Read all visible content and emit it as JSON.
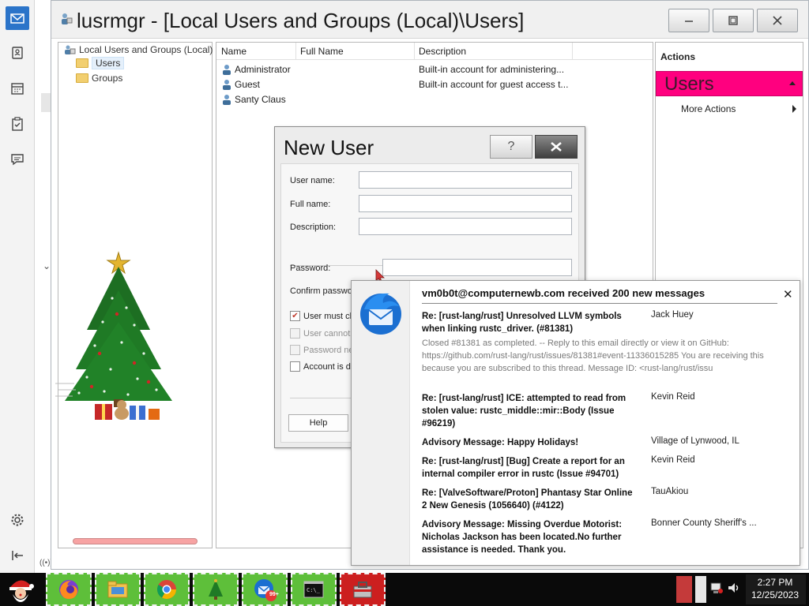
{
  "window": {
    "title": "lusrmgr - [Local Users and Groups (Local)\\Users]"
  },
  "tree": {
    "root": "Local Users and Groups (Local)",
    "items": [
      "Users",
      "Groups"
    ]
  },
  "list": {
    "columns": [
      "Name",
      "Full Name",
      "Description"
    ],
    "rows": [
      {
        "name": "Administrator",
        "full_name": "",
        "description": "Built-in account for administering..."
      },
      {
        "name": "Guest",
        "full_name": "",
        "description": "Built-in account for guest access t..."
      },
      {
        "name": "Santy Claus",
        "full_name": "",
        "description": ""
      }
    ]
  },
  "actions": {
    "title": "Actions",
    "section": "Users",
    "more": "More Actions"
  },
  "dialog": {
    "title": "New User",
    "help_glyph": "?",
    "fields": {
      "user_name": "User name:",
      "full_name": "Full name:",
      "description": "Description:",
      "password": "Password:",
      "confirm": "Confirm passwo"
    },
    "checks": [
      {
        "label": "User must ch",
        "checked": true,
        "disabled": false
      },
      {
        "label": "User cannot",
        "checked": false,
        "disabled": true
      },
      {
        "label": "Password ne",
        "checked": false,
        "disabled": true
      },
      {
        "label": "Account is di",
        "checked": false,
        "disabled": false
      }
    ],
    "help_button": "Help"
  },
  "notification": {
    "header": "vm0b0t@computernewb.com received 200 new messages",
    "messages": [
      {
        "subject": "Re: [rust-lang/rust] Unresolved LLVM symbols when linking rustc_driver. (#81381)",
        "from": "Jack Huey",
        "preview": "Closed #81381 as completed. -- Reply to this email directly or view it on GitHub: https://github.com/rust-lang/rust/issues/81381#event-11336015285 You are receiving this because you are subscribed to this thread. Message ID: <rust-lang/rust/issu"
      },
      {
        "subject": "Re: [rust-lang/rust] ICE: attempted to read from stolen value: rustc_middle::mir::Body (Issue #96219)",
        "from": "Kevin Reid",
        "preview": ""
      },
      {
        "subject": "Advisory Message: Happy Holidays!",
        "from": "Village of Lynwood, IL",
        "preview": ""
      },
      {
        "subject": "Re: [rust-lang/rust] [Bug] Create a report for an internal compiler error in rustc (Issue #94701)",
        "from": "Kevin Reid",
        "preview": ""
      },
      {
        "subject": "Re: [ValveSoftware/Proton] Phantasy Star Online 2 New Genesis (1056640) (#4122)",
        "from": "TauAkiou",
        "preview": ""
      },
      {
        "subject": "Advisory Message: Missing Overdue Motorist: Nicholas Jackson has been located.No further assistance is needed. Thank you.",
        "from": "Bonner County Sheriff's ...",
        "preview": ""
      }
    ]
  },
  "taskbar": {
    "badge": "99+",
    "time": "2:27 PM",
    "date": "12/25/2023"
  },
  "colors": {
    "actions_section": "#ff007f",
    "taskbar_button": "#5ebf3a",
    "rail_active": "#2b74c9"
  }
}
